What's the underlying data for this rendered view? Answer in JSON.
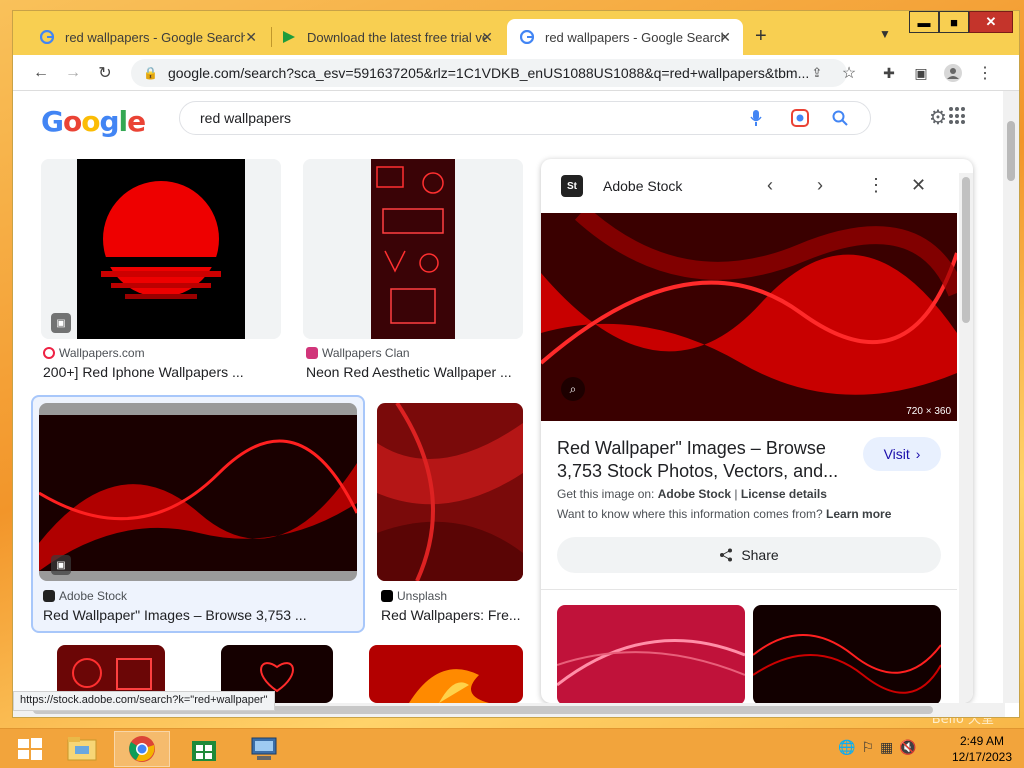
{
  "desktop": {
    "corner_text": "Bello 天堂"
  },
  "tabs": [
    {
      "title": "red wallpapers - Google Search",
      "icon": "google-g-icon"
    },
    {
      "title": "Download the latest free trial ver",
      "icon": "download-arrow-icon"
    },
    {
      "title": "red wallpapers - Google Search",
      "icon": "google-g-icon"
    }
  ],
  "window_controls": {
    "minimize": "▬",
    "maximize": "■",
    "close": "✕"
  },
  "toolbar": {
    "url": "google.com/search?sca_esv=591637205&rlz=1C1VDKB_enUS1088US1088&q=red+wallpapers&tbm..."
  },
  "search": {
    "logo": "Google",
    "query": "red wallpapers"
  },
  "results": [
    {
      "source": "Wallpapers.com",
      "title": "200+] Red Iphone Wallpapers ..."
    },
    {
      "source": "Wallpapers Clan",
      "title": "Neon Red Aesthetic Wallpaper ..."
    },
    {
      "source": "Adobe Stock",
      "title": "Red Wallpaper\" Images – Browse 3,753 ..."
    },
    {
      "source": "Unsplash",
      "title": "Red Wallpapers: Fre..."
    }
  ],
  "panel": {
    "source": "Adobe Stock",
    "source_logo": "St",
    "dimensions": "720 × 360",
    "title": "Red Wallpaper\" Images – Browse 3,753 Stock Photos, Vectors, and...",
    "visit": "Visit",
    "get_prefix": "Get this image on:",
    "get_source": "Adobe Stock",
    "license": "License details",
    "info_prefix": "Want to know where this information comes from?",
    "learn_more": "Learn more",
    "share": "Share"
  },
  "status_url": "https://stock.adobe.com/search?k=\"red+wallpaper\"",
  "taskbar": {
    "time": "2:49 AM",
    "date": "12/17/2023"
  },
  "colors": {
    "tabbar": "#f8cf51",
    "taskbar": "#f2a43c",
    "accent_link": "#1a0dab",
    "selected_outline": "#a8c7fa"
  }
}
